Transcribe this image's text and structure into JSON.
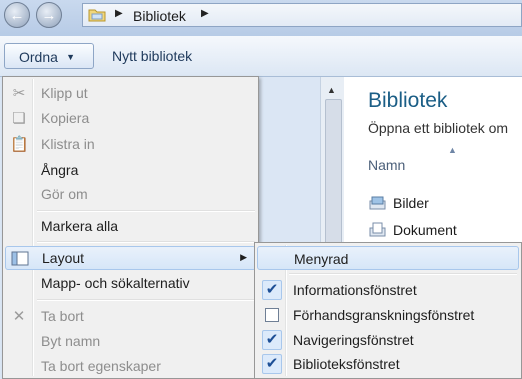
{
  "address": {
    "breadcrumb": "Bibliotek"
  },
  "toolbar": {
    "organize_label": "Ordna",
    "new_library_label": "Nytt bibliotek"
  },
  "content": {
    "title": "Bibliotek",
    "subtitle": "Öppna ett bibliotek om",
    "column_header": "Namn",
    "items": [
      {
        "label": "Bilder",
        "icon": "pictures-library-icon"
      },
      {
        "label": "Dokument",
        "icon": "documents-library-icon"
      }
    ]
  },
  "organize_menu": {
    "items": [
      {
        "label": "Klipp ut",
        "icon": "scissors-icon",
        "disabled": true
      },
      {
        "label": "Kopiera",
        "icon": "copy-icon",
        "disabled": true
      },
      {
        "label": "Klistra in",
        "icon": "paste-icon",
        "disabled": true
      },
      {
        "label": "Ångra",
        "disabled": false
      },
      {
        "label": "Gör om",
        "disabled": true
      },
      {
        "label": "Markera alla",
        "disabled": false
      },
      {
        "label": "Layout",
        "icon": "layout-icon",
        "disabled": false,
        "highlighted": true,
        "has_submenu": true
      },
      {
        "label": "Mapp- och sökalternativ",
        "disabled": false
      },
      {
        "label": "Ta bort",
        "icon": "delete-x-icon",
        "disabled": true
      },
      {
        "label": "Byt namn",
        "disabled": true
      },
      {
        "label": "Ta bort egenskaper",
        "disabled": true
      }
    ]
  },
  "layout_submenu": {
    "items": [
      {
        "label": "Menyrad",
        "checked": false,
        "highlighted": true
      },
      {
        "label": "Informationsfönstret",
        "checked": true
      },
      {
        "label": "Förhandsgranskningsfönstret",
        "checked": false
      },
      {
        "label": "Navigeringsfönstret",
        "checked": true
      },
      {
        "label": "Biblioteksfönstret",
        "checked": true
      }
    ]
  },
  "colors": {
    "accent": "#1b5e86",
    "highlight": "#d6e6f8",
    "menu_bg": "#f0f0f0"
  }
}
